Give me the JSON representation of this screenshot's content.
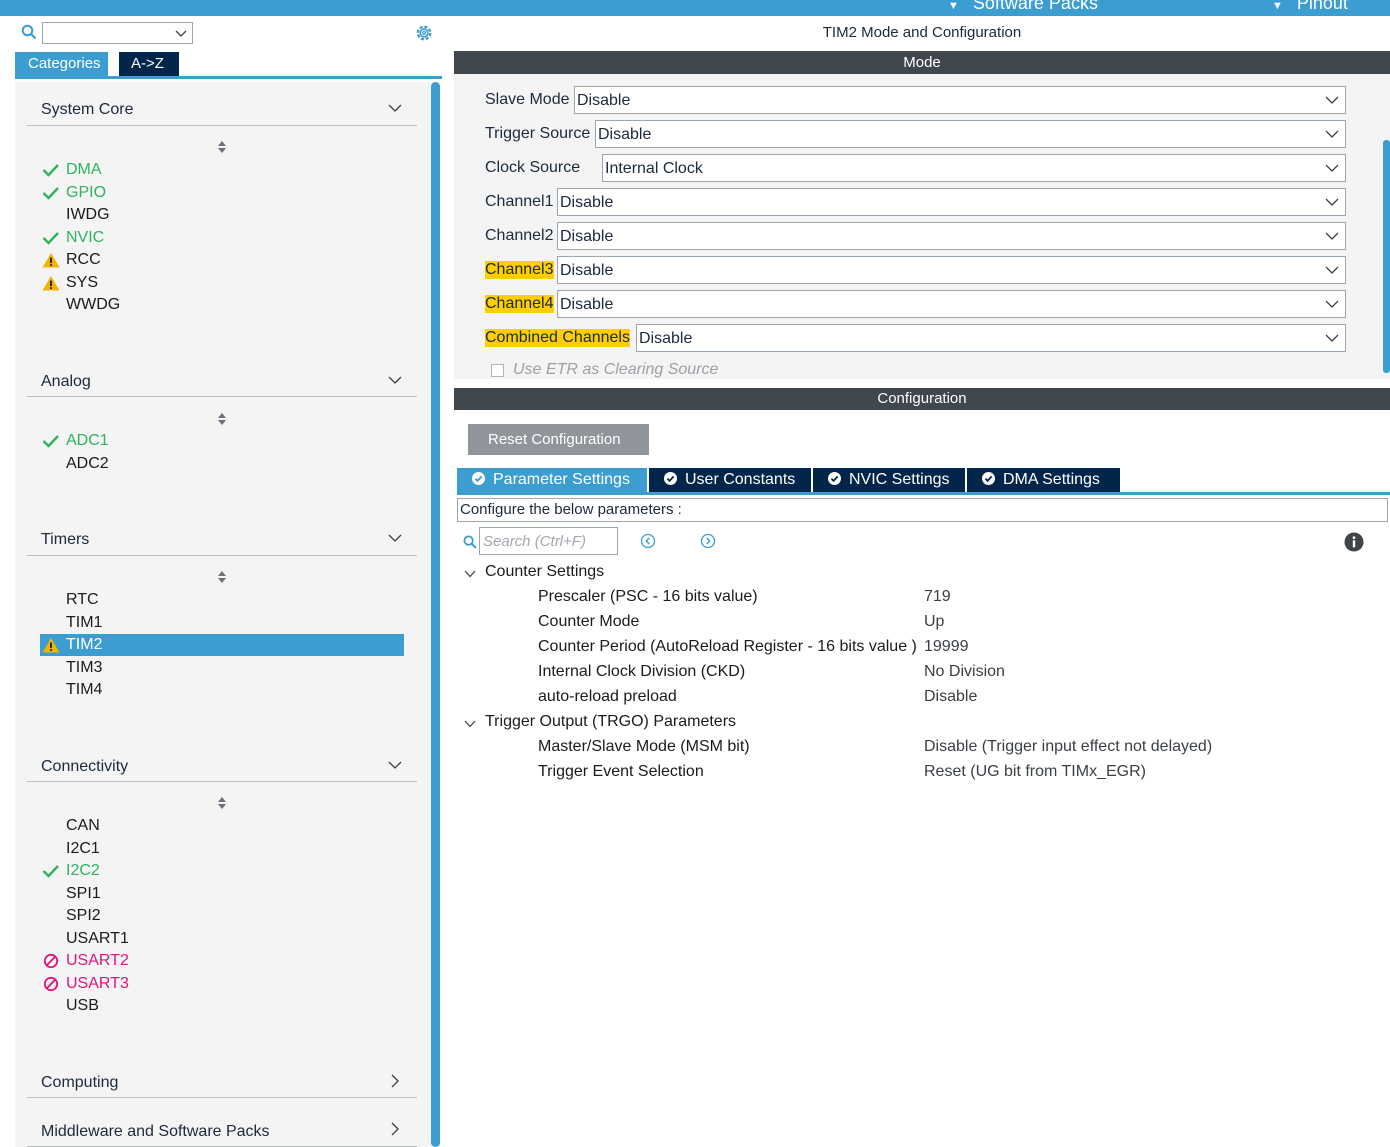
{
  "topbar": {
    "software_packs": "Software Packs",
    "pinout": "Pinout"
  },
  "left": {
    "search_value": "",
    "tabs": {
      "categories": "Categories",
      "az": "A->Z"
    },
    "categories": {
      "system_core": {
        "label": "System Core",
        "items": [
          {
            "label": "DMA",
            "status": "ok"
          },
          {
            "label": "GPIO",
            "status": "ok"
          },
          {
            "label": "IWDG",
            "status": "none"
          },
          {
            "label": "NVIC",
            "status": "ok"
          },
          {
            "label": "RCC",
            "status": "warning"
          },
          {
            "label": "SYS",
            "status": "warning"
          },
          {
            "label": "WWDG",
            "status": "none"
          }
        ]
      },
      "analog": {
        "label": "Analog",
        "items": [
          {
            "label": "ADC1",
            "status": "ok"
          },
          {
            "label": "ADC2",
            "status": "none"
          }
        ]
      },
      "timers": {
        "label": "Timers",
        "items": [
          {
            "label": "RTC",
            "status": "none"
          },
          {
            "label": "TIM1",
            "status": "none"
          },
          {
            "label": "TIM2",
            "status": "warning",
            "selected": true
          },
          {
            "label": "TIM3",
            "status": "none"
          },
          {
            "label": "TIM4",
            "status": "none"
          }
        ]
      },
      "connectivity": {
        "label": "Connectivity",
        "items": [
          {
            "label": "CAN",
            "status": "none"
          },
          {
            "label": "I2C1",
            "status": "none"
          },
          {
            "label": "I2C2",
            "status": "ok"
          },
          {
            "label": "SPI1",
            "status": "none"
          },
          {
            "label": "SPI2",
            "status": "none"
          },
          {
            "label": "USART1",
            "status": "none"
          },
          {
            "label": "USART2",
            "status": "disabled"
          },
          {
            "label": "USART3",
            "status": "disabled"
          },
          {
            "label": "USB",
            "status": "none"
          }
        ]
      },
      "computing": {
        "label": "Computing"
      },
      "middleware": {
        "label": "Middleware and Software Packs"
      }
    }
  },
  "right": {
    "title": "TIM2 Mode and Configuration",
    "mode_header": "Mode",
    "mode": {
      "slave_mode": {
        "label": "Slave Mode",
        "value": "Disable"
      },
      "trigger_source": {
        "label": "Trigger Source",
        "value": "Disable"
      },
      "clock_source": {
        "label": "Clock Source",
        "value": "Internal Clock"
      },
      "channel1": {
        "label": "Channel1",
        "value": "Disable"
      },
      "channel2": {
        "label": "Channel2",
        "value": "Disable"
      },
      "channel3": {
        "label": "Channel3",
        "value": "Disable"
      },
      "channel4": {
        "label": "Channel4",
        "value": "Disable"
      },
      "combined_channels": {
        "label": "Combined Channels",
        "value": "Disable"
      },
      "use_etr": {
        "label": "Use ETR as Clearing Source",
        "checked": false
      }
    },
    "config_header": "Configuration",
    "reset_button": "Reset Configuration",
    "tabs": {
      "parameter": "Parameter Settings",
      "user": "User Constants",
      "nvic": "NVIC Settings",
      "dma": "DMA Settings"
    },
    "configure_hint": "Configure the below parameters :",
    "search_placeholder": "Search (Ctrl+F)",
    "groups": {
      "counter": {
        "label": "Counter Settings",
        "params": [
          {
            "name": "Prescaler (PSC - 16 bits value)",
            "value": "719"
          },
          {
            "name": "Counter Mode",
            "value": "Up"
          },
          {
            "name": "Counter Period (AutoReload Register - 16 bits value )",
            "value": "19999"
          },
          {
            "name": "Internal Clock Division (CKD)",
            "value": "No Division"
          },
          {
            "name": "auto-reload preload",
            "value": "Disable"
          }
        ]
      },
      "trgo": {
        "label": "Trigger Output (TRGO) Parameters",
        "params": [
          {
            "name": "Master/Slave Mode (MSM bit)",
            "value": "Disable (Trigger input effect not delayed)"
          },
          {
            "name": "Trigger Event Selection",
            "value": "Reset (UG bit from TIMx_EGR)"
          }
        ]
      }
    }
  },
  "colors": {
    "accent": "#3c9dd0",
    "dark_tab": "#02254a",
    "section_bar": "#40474e",
    "ok": "#2fb35c",
    "warning": "#f0b400",
    "disabled": "#e0157a",
    "highlight": "#ffce00"
  },
  "icons": {
    "search": "search-icon",
    "gear": "gear-icon",
    "ok": "check-icon",
    "warning": "warning-icon",
    "disabled": "forbidden-icon",
    "sort": "sort-icon",
    "info": "info-icon"
  }
}
